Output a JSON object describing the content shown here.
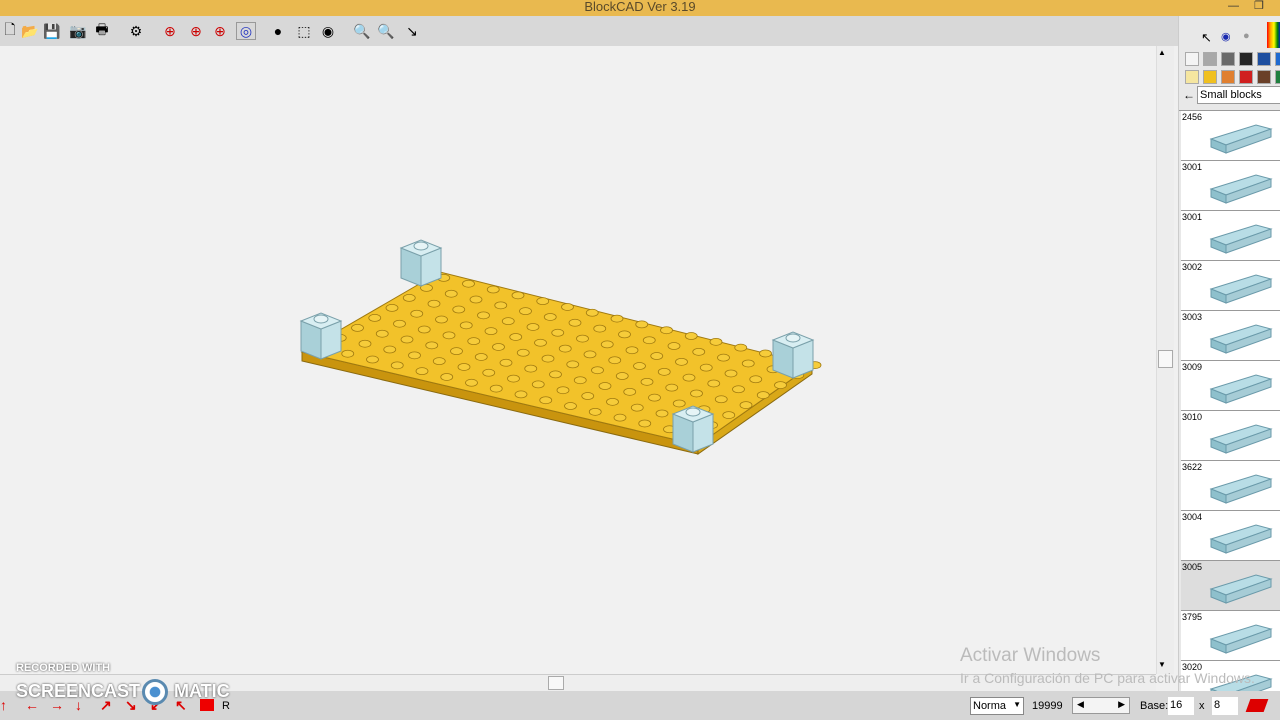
{
  "title": "BlockCAD Ver 3.19",
  "toolbar": {
    "icons": [
      "new-icon",
      "open-icon",
      "save-icon",
      "camera-icon",
      "print-icon",
      "settings-icon",
      "rotate-y-icon",
      "rotate-x-icon",
      "rotate-z-icon",
      "rotate-free-icon",
      "view-ball-icon",
      "wireframe-icon",
      "eye-icon",
      "zoom-in-icon",
      "zoom-out-icon",
      "eraser-icon"
    ]
  },
  "palette": {
    "colors": [
      "#f4f4f4",
      "#a8a8a8",
      "#6a6a6a",
      "#252525",
      "#1e4fa0",
      "#1e6ad0",
      "#f5e6a0",
      "#f0c020",
      "#e08030",
      "#d02020",
      "#6a4028",
      "#208040"
    ]
  },
  "category": "Small blocks",
  "parts": [
    {
      "id": "2456"
    },
    {
      "id": "3001"
    },
    {
      "id": "3001"
    },
    {
      "id": "3002"
    },
    {
      "id": "3003"
    },
    {
      "id": "3009"
    },
    {
      "id": "3010"
    },
    {
      "id": "3622"
    },
    {
      "id": "3004"
    },
    {
      "id": "3005",
      "selected": true
    },
    {
      "id": "3795"
    },
    {
      "id": "3020"
    }
  ],
  "status": {
    "mode": "Norma",
    "count": "19999",
    "base_label": "Base:",
    "base_w": "16",
    "x_label": "x",
    "base_h": "8",
    "r_label": "R"
  },
  "watermark": {
    "line1": "Activar Windows",
    "line2": "Ir a Configuración de PC para activar Windows.",
    "rec1": "RECORDED WITH",
    "rec2": "SCREENCAST",
    "rec3": "MATIC"
  }
}
